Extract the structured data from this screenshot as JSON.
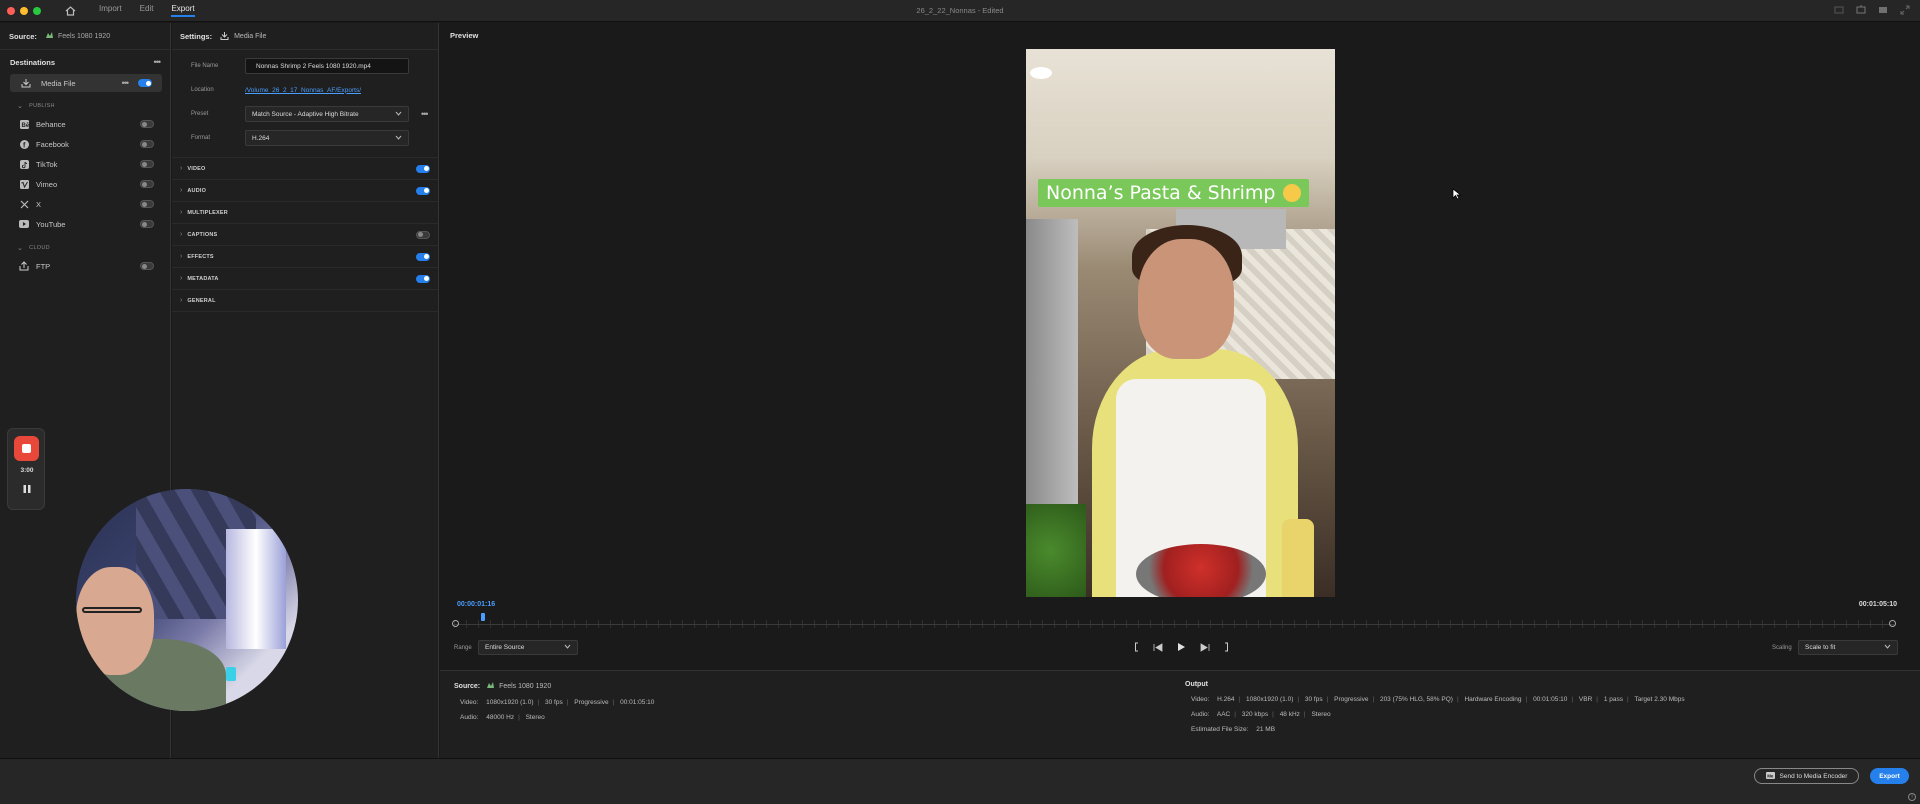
{
  "titlebar": {
    "title": "26_2_22_Nonnas - Edited",
    "menu": [
      "Import",
      "Edit",
      "Export"
    ],
    "active_menu": "Export"
  },
  "source": {
    "label": "Source:",
    "name": "Feels 1080 1920"
  },
  "destinations": {
    "header": "Destinations",
    "media_file": {
      "label": "Media File",
      "enabled": true
    },
    "publish_label": "PUBLISH",
    "publish": [
      {
        "label": "Behance",
        "icon": "behance-icon"
      },
      {
        "label": "Facebook",
        "icon": "facebook-icon"
      },
      {
        "label": "TikTok",
        "icon": "tiktok-icon"
      },
      {
        "label": "Vimeo",
        "icon": "vimeo-icon"
      },
      {
        "label": "X",
        "icon": "x-icon"
      },
      {
        "label": "YouTube",
        "icon": "youtube-icon"
      }
    ],
    "cloud_label": "CLOUD",
    "cloud": [
      {
        "label": "FTP",
        "icon": "upload-icon"
      }
    ]
  },
  "settings": {
    "label": "Settings:",
    "target": "Media File",
    "file_name_label": "File Name",
    "file_name": "Nonnas Shrimp 2 Feels 1080 1920.mp4",
    "location_label": "Location",
    "location": "/Volume_26_2_17_Nonnas_AF/Exports/",
    "preset_label": "Preset",
    "preset": "Match Source - Adaptive High Bitrate",
    "format_label": "Format",
    "format": "H.264",
    "sections": [
      {
        "label": "VIDEO",
        "enabled": true
      },
      {
        "label": "AUDIO",
        "enabled": true
      },
      {
        "label": "MULTIPLEXER",
        "enabled": null
      },
      {
        "label": "CAPTIONS",
        "enabled": false
      },
      {
        "label": "EFFECTS",
        "enabled": true
      },
      {
        "label": "METADATA",
        "enabled": true
      },
      {
        "label": "GENERAL",
        "enabled": null
      }
    ]
  },
  "preview": {
    "label": "Preview",
    "overlay_title": "Nonna’s Pasta & Shrimp",
    "timecode_current": "00:00:01:16",
    "timecode_total": "00:01:05:10",
    "playhead_fraction": 0.0187,
    "range_label": "Range",
    "range_value": "Entire Source",
    "scaling_label": "Scaling",
    "scaling_value": "Scale to fit"
  },
  "source_info": {
    "title": "Source:",
    "name": "Feels 1080 1920",
    "video_label": "Video:",
    "video": [
      "1080x1920 (1.0)",
      "30 fps",
      "Progressive",
      "00:01:05:10"
    ],
    "audio_label": "Audio:",
    "audio": [
      "48000 Hz",
      "Stereo"
    ]
  },
  "output_info": {
    "title": "Output",
    "video_label": "Video:",
    "video": [
      "H.264",
      "1080x1920 (1.0)",
      "30 fps",
      "Progressive",
      "203 (75% HLG, 58% PQ)",
      "Hardware Encoding",
      "00:01:05:10",
      "VBR",
      "1 pass",
      "Target 2.30 Mbps"
    ],
    "audio_label": "Audio:",
    "audio": [
      "AAC",
      "320 kbps",
      "48 kHz",
      "Stereo"
    ],
    "size_label": "Estimated File Size:",
    "size": "21 MB"
  },
  "footer": {
    "send_label": "Send to Media Encoder",
    "export_label": "Export"
  },
  "recorder": {
    "time": "3:00"
  },
  "colors": {
    "accent": "#2680eb",
    "record": "#e8483a",
    "overlay": "#7ac85a"
  }
}
